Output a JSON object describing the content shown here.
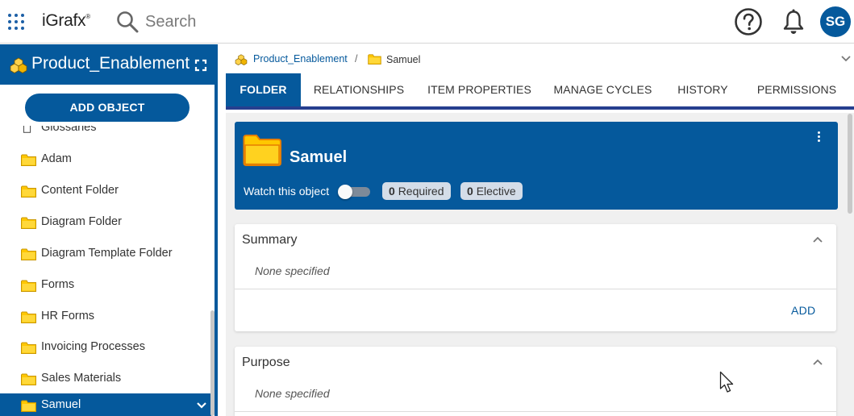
{
  "header": {
    "logo": "iGrafx",
    "logo_mark": "®",
    "search_placeholder": "Search",
    "avatar_initials": "SG"
  },
  "sidebar": {
    "project_title": "Product_Enablement",
    "add_object_label": "ADD OBJECT",
    "items": [
      {
        "label": "Glossaries",
        "icon": "document-icon"
      },
      {
        "label": "Adam",
        "icon": "folder-icon"
      },
      {
        "label": "Content Folder",
        "icon": "folder-icon"
      },
      {
        "label": "Diagram Folder",
        "icon": "folder-icon"
      },
      {
        "label": "Diagram Template Folder",
        "icon": "folder-icon"
      },
      {
        "label": "Forms",
        "icon": "folder-icon"
      },
      {
        "label": "HR Forms",
        "icon": "folder-icon"
      },
      {
        "label": "Invoicing Processes",
        "icon": "folder-icon"
      },
      {
        "label": "Sales Materials",
        "icon": "folder-icon"
      },
      {
        "label": "Samuel",
        "icon": "folder-icon",
        "selected": true
      }
    ]
  },
  "breadcrumb": {
    "project": "Product_Enablement",
    "separator": "/",
    "current": "Samuel"
  },
  "tabs": [
    {
      "label": "FOLDER",
      "active": true
    },
    {
      "label": "RELATIONSHIPS"
    },
    {
      "label": "ITEM PROPERTIES"
    },
    {
      "label": "MANAGE CYCLES"
    },
    {
      "label": "HISTORY"
    },
    {
      "label": "PERMISSIONS"
    }
  ],
  "object": {
    "title": "Samuel",
    "watch_label": "Watch this object",
    "watching": false,
    "required_count": "0",
    "required_label": "Required",
    "elective_count": "0",
    "elective_label": "Elective"
  },
  "sections": [
    {
      "title": "Summary",
      "value": "None specified",
      "add_label": "ADD"
    },
    {
      "title": "Purpose",
      "value": "None specified"
    }
  ],
  "colors": {
    "primary": "#05599c",
    "tab_underline": "#263f8f",
    "folder": "#ffc700",
    "badge_bg": "#d4dde8"
  }
}
